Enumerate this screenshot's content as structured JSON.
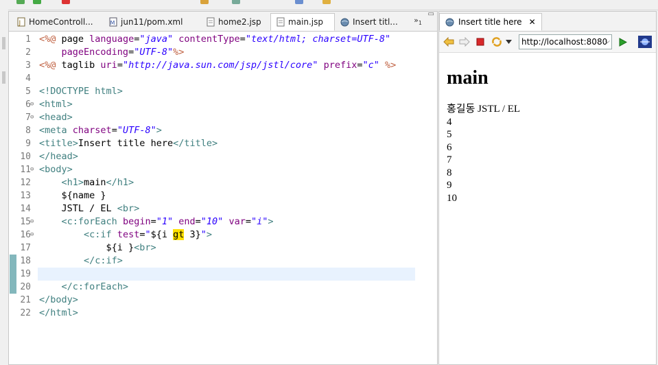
{
  "editor": {
    "tabs": [
      {
        "label": "HomeControll...",
        "icon": "java-file-icon"
      },
      {
        "label": "jun11/pom.xml",
        "icon": "maven-file-icon"
      },
      {
        "label": "home2.jsp",
        "icon": "jsp-file-icon"
      },
      {
        "label": "main.jsp",
        "icon": "jsp-file-icon",
        "active": true
      },
      {
        "label": "Insert titl...",
        "icon": "web-browser-icon"
      }
    ],
    "overflow_count": "1",
    "overflow_glyph": "»",
    "minmax_glyph": "▭",
    "close_glyph": "✕",
    "fold_glyph": "⊖",
    "lines": [
      {
        "n": "1",
        "tokens": [
          {
            "c": "jsp",
            "t": "<%@"
          },
          {
            "c": "txt",
            "t": " page "
          },
          {
            "c": "attr",
            "t": "language"
          },
          {
            "c": "txt",
            "t": "="
          },
          {
            "c": "str",
            "t": "\"java\""
          },
          {
            "c": "txt",
            "t": " "
          },
          {
            "c": "attr",
            "t": "contentType"
          },
          {
            "c": "txt",
            "t": "="
          },
          {
            "c": "str",
            "t": "\"text/html; charset=UTF-8\""
          }
        ]
      },
      {
        "n": "2",
        "tokens": [
          {
            "c": "txt",
            "t": "    "
          },
          {
            "c": "attr",
            "t": "pageEncoding"
          },
          {
            "c": "txt",
            "t": "="
          },
          {
            "c": "str",
            "t": "\"UTF-8\""
          },
          {
            "c": "jsp",
            "t": "%>"
          }
        ]
      },
      {
        "n": "3",
        "tokens": [
          {
            "c": "jsp",
            "t": "<%@"
          },
          {
            "c": "txt",
            "t": " taglib "
          },
          {
            "c": "attr",
            "t": "uri"
          },
          {
            "c": "txt",
            "t": "="
          },
          {
            "c": "str",
            "t": "\"http://java.sun.com/jsp/jstl/core\""
          },
          {
            "c": "txt",
            "t": " "
          },
          {
            "c": "attr",
            "t": "prefix"
          },
          {
            "c": "txt",
            "t": "="
          },
          {
            "c": "str",
            "t": "\"c\""
          },
          {
            "c": "txt",
            "t": " "
          },
          {
            "c": "jsp",
            "t": "%>"
          }
        ]
      },
      {
        "n": "4",
        "tokens": []
      },
      {
        "n": "5",
        "tokens": [
          {
            "c": "tag",
            "t": "<!DOCTYPE html>"
          }
        ]
      },
      {
        "n": "6",
        "fold": true,
        "tokens": [
          {
            "c": "tag",
            "t": "<html>"
          }
        ]
      },
      {
        "n": "7",
        "fold": true,
        "tokens": [
          {
            "c": "tag",
            "t": "<head>"
          }
        ]
      },
      {
        "n": "8",
        "tokens": [
          {
            "c": "tag",
            "t": "<meta"
          },
          {
            "c": "txt",
            "t": " "
          },
          {
            "c": "attr",
            "t": "charset"
          },
          {
            "c": "txt",
            "t": "="
          },
          {
            "c": "str",
            "t": "\"UTF-8\""
          },
          {
            "c": "tag",
            "t": ">"
          }
        ]
      },
      {
        "n": "9",
        "tokens": [
          {
            "c": "tag",
            "t": "<title>"
          },
          {
            "c": "txt",
            "t": "Insert title here"
          },
          {
            "c": "tag",
            "t": "</title>"
          }
        ]
      },
      {
        "n": "10",
        "tokens": [
          {
            "c": "tag",
            "t": "</head>"
          }
        ]
      },
      {
        "n": "11",
        "fold": true,
        "tokens": [
          {
            "c": "tag",
            "t": "<body>"
          }
        ]
      },
      {
        "n": "12",
        "tokens": [
          {
            "c": "txt",
            "t": "    "
          },
          {
            "c": "tag",
            "t": "<h1>"
          },
          {
            "c": "txt",
            "t": "main"
          },
          {
            "c": "tag",
            "t": "</h1>"
          }
        ]
      },
      {
        "n": "13",
        "tokens": [
          {
            "c": "txt",
            "t": "    ${name }"
          }
        ]
      },
      {
        "n": "14",
        "tokens": [
          {
            "c": "txt",
            "t": "    JSTL / EL "
          },
          {
            "c": "tag",
            "t": "<br>"
          }
        ]
      },
      {
        "n": "15",
        "fold": true,
        "tokens": [
          {
            "c": "txt",
            "t": "    "
          },
          {
            "c": "tag",
            "t": "<c:forEach"
          },
          {
            "c": "txt",
            "t": " "
          },
          {
            "c": "attr",
            "t": "begin"
          },
          {
            "c": "txt",
            "t": "="
          },
          {
            "c": "str",
            "t": "\"1\""
          },
          {
            "c": "txt",
            "t": " "
          },
          {
            "c": "attr",
            "t": "end"
          },
          {
            "c": "txt",
            "t": "="
          },
          {
            "c": "str",
            "t": "\"10\""
          },
          {
            "c": "txt",
            "t": " "
          },
          {
            "c": "attr",
            "t": "var"
          },
          {
            "c": "txt",
            "t": "="
          },
          {
            "c": "str",
            "t": "\"i\""
          },
          {
            "c": "tag",
            "t": ">"
          }
        ]
      },
      {
        "n": "16",
        "fold": true,
        "tokens": [
          {
            "c": "txt",
            "t": "        "
          },
          {
            "c": "tag",
            "t": "<c:if"
          },
          {
            "c": "txt",
            "t": " "
          },
          {
            "c": "attr",
            "t": "test"
          },
          {
            "c": "txt",
            "t": "="
          },
          {
            "c": "str",
            "t": "\""
          },
          {
            "c": "txt",
            "t": "${i "
          },
          {
            "c": "hl",
            "t": "gt"
          },
          {
            "c": "txt",
            "t": " 3}"
          },
          {
            "c": "str",
            "t": "\""
          },
          {
            "c": "tag",
            "t": ">"
          }
        ]
      },
      {
        "n": "17",
        "tokens": [
          {
            "c": "txt",
            "t": "            ${i }"
          },
          {
            "c": "tag",
            "t": "<br>"
          }
        ]
      },
      {
        "n": "18",
        "change": true,
        "tokens": [
          {
            "c": "txt",
            "t": "        "
          },
          {
            "c": "tag",
            "t": "</c:if>"
          }
        ]
      },
      {
        "n": "19",
        "change": true,
        "current": true,
        "tokens": []
      },
      {
        "n": "20",
        "change": true,
        "tokens": [
          {
            "c": "txt",
            "t": "    "
          },
          {
            "c": "tag",
            "t": "</c:forEach>"
          }
        ]
      },
      {
        "n": "21",
        "tokens": [
          {
            "c": "tag",
            "t": "</body>"
          }
        ]
      },
      {
        "n": "22",
        "tokens": [
          {
            "c": "tag",
            "t": "</html>"
          }
        ]
      }
    ]
  },
  "browser": {
    "tab_label": "Insert title here",
    "url": "http://localhost:8080",
    "dropdown_glyph": "⌵",
    "toolbar_icons": [
      "back-icon",
      "forward-icon",
      "stop-icon",
      "refresh-icon",
      "menu-dropdown-icon",
      "go-icon",
      "eclipse-browser-icon"
    ],
    "heading": "main",
    "lines": [
      "홍길동 JSTL / EL",
      "4",
      "5",
      "6",
      "7",
      "8",
      "9",
      "10"
    ]
  },
  "colors": {
    "jsp_directive": "#bf5f3f",
    "tag": "#3f7f7f",
    "attribute": "#7f007f",
    "string": "#2a00ff",
    "highlight": "#ffe000",
    "current_line": "#e8f2fe"
  }
}
